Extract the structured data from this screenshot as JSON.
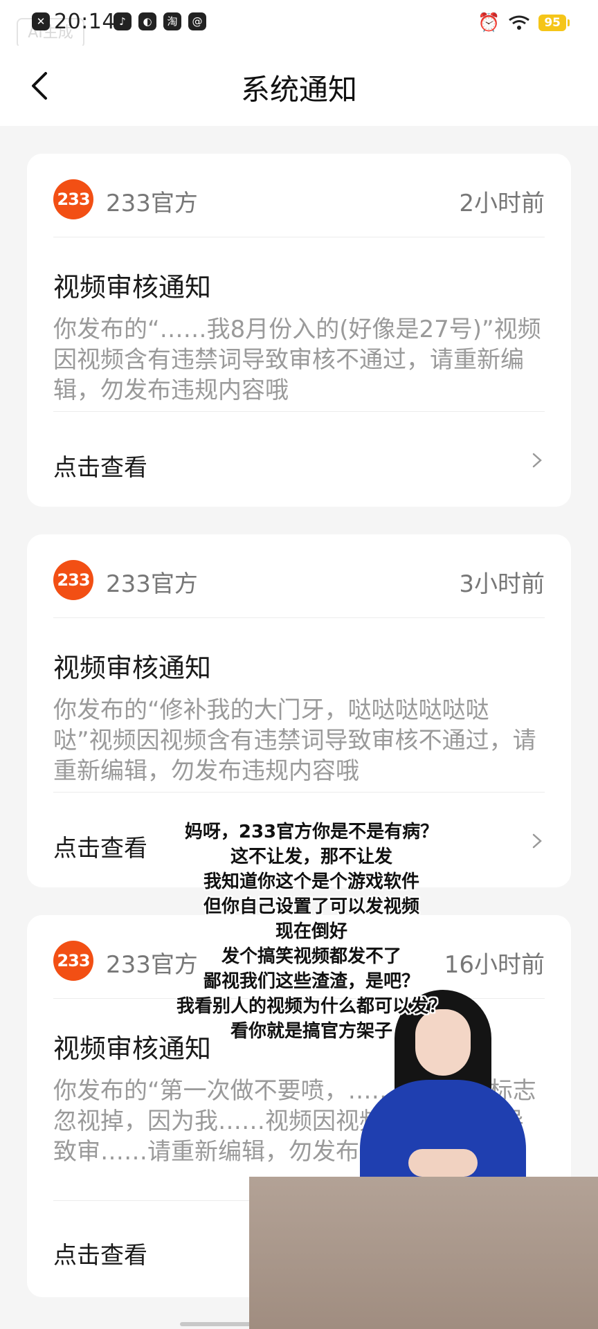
{
  "status_bar": {
    "time": "20:14",
    "battery": "95",
    "watermark": "AI生成",
    "left_icons": [
      "close-icon",
      "tiktok-icon",
      "app-icon",
      "taobao-icon",
      "email-icon"
    ],
    "right_icons": [
      "alarm-icon",
      "wifi-icon",
      "battery-icon"
    ]
  },
  "header": {
    "title": "系统通知"
  },
  "notifications": [
    {
      "sender": "233官方",
      "logo_text": "233",
      "time": "2小时前",
      "title": "视频审核通知",
      "body": "你发布的“……我8月份入的(好像是27号)”视频因视频含有违禁词导致审核不通过，请重新编辑，勿发布违规内容哦",
      "action": "点击查看"
    },
    {
      "sender": "233官方",
      "logo_text": "233",
      "time": "3小时前",
      "title": "视频审核通知",
      "body": "你发布的“修补我的大门牙，哒哒哒哒哒哒哒”视频因视频含有违禁词导致审核不通过，请重新编辑，勿发布违规内容哦",
      "action": "点击查看"
    },
    {
      "sender": "233官方",
      "logo_text": "233",
      "time": "16小时前",
      "title": "视频审核通知",
      "body": "你发布的“第一次做不要喷，……面快影的标志忽视掉，因为我……视频因视频内容不合格导致审……请重新编辑，勿发布违…",
      "action": "点击查看"
    }
  ],
  "caption_lines": [
    "妈呀，233官方你是不是有病？",
    "这不让发，那不让发",
    "我知道你这个是个游戏软件",
    "但你自己设置了可以发视频",
    "现在倒好",
    "发个搞笑视频都发不了",
    "鄙视我们这些渣渣，是吧？",
    "我看别人的视频为什么都可以发？",
    "看你就是搞官方架子"
  ],
  "colors": {
    "logo": "#f24f14",
    "background": "#f5f5f5",
    "battery": "#f5c518"
  }
}
